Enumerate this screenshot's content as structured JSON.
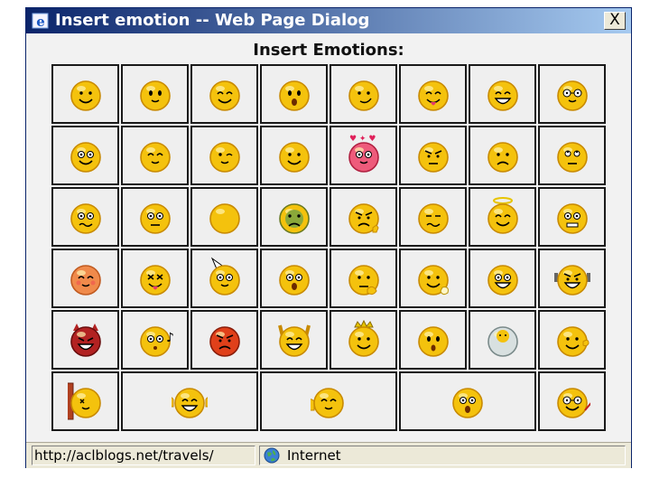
{
  "window": {
    "title": "Insert emotion -- Web Page Dialog",
    "close_label": "X"
  },
  "dialog": {
    "heading": "Insert Emotions:"
  },
  "emoticons": [
    "smile",
    "slight-smile",
    "happy-closed-eyes",
    "surprised",
    "content-smile",
    "tongue-out",
    "big-grin",
    "nerd-glasses",
    "glasses-smile",
    "relieved",
    "wink",
    "smile-wide",
    "love-struck",
    "annoyed",
    "frown",
    "rolling-eyes",
    "worried",
    "confused",
    "plain-face",
    "green-sick",
    "angry-shaking-fist",
    "tired",
    "angel",
    "scared",
    "blushing",
    "sick-tongue",
    "party-hat",
    "shocked",
    "thinking",
    "waving",
    "laughing",
    "flexing",
    "devil",
    "whistling",
    "angry-red",
    "cheering",
    "king",
    "surprised-oh",
    "toilet",
    "clapping",
    "bashing-wall",
    "thumbs-up",
    "shy-hand",
    "dancing-trio",
    "glasses-writing"
  ],
  "status": {
    "url": "http://aclblogs.net/travels/",
    "zone": "Internet"
  },
  "colors": {
    "face": "#f4c20d",
    "face_dark": "#c88a00",
    "pink_face": "#ee5b7b",
    "red_face": "#e0401a",
    "devil": "#b22222",
    "title_start": "#0a246a",
    "title_end": "#a6caf0"
  }
}
